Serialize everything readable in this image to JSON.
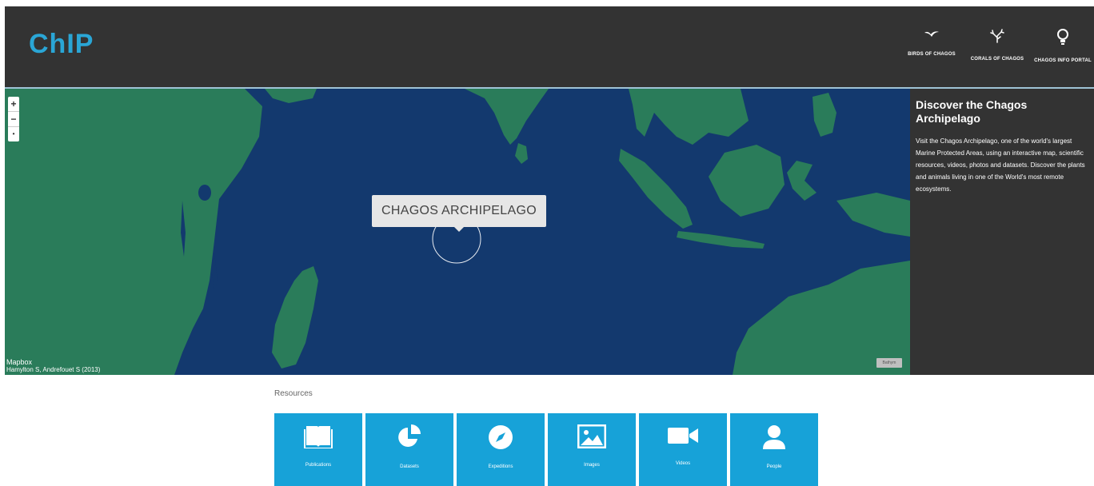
{
  "header": {
    "logo": "ChIP",
    "logo_subtitle": "",
    "nav": [
      {
        "label": "BIRDS OF CHAGOS",
        "icon": "bird-icon"
      },
      {
        "label": "CORALS OF CHAGOS",
        "icon": "coral-icon"
      },
      {
        "label": "CHAGOS INFO PORTAL",
        "icon": "lightbulb-icon"
      }
    ]
  },
  "map": {
    "zoom_in": "+",
    "zoom_out": "−",
    "reset": "•",
    "label": "CHAGOS ARCHIPELAGO",
    "attribution_logo": "Mapbox",
    "attribution": "Hamylton S, Andrefouet S (2013)",
    "corner_button": "Bathym"
  },
  "info": {
    "title": "Discover the Chagos Archipelago",
    "body": "Visit the Chagos Archipelago, one of the world's largest Marine Protected Areas, using an interactive map, scientific resources, videos, photos and datasets. Discover the plants and animals living in one of the World's most remote ecosystems."
  },
  "resources": {
    "title": "Resources",
    "tiles": [
      {
        "label": "Publications",
        "icon": "book-icon"
      },
      {
        "label": "Datasets",
        "icon": "pie-chart-icon"
      },
      {
        "label": "Expeditions",
        "icon": "compass-icon"
      },
      {
        "label": "Images",
        "icon": "image-icon"
      },
      {
        "label": "Videos",
        "icon": "video-camera-icon"
      },
      {
        "label": "People",
        "icon": "person-icon"
      }
    ]
  },
  "colors": {
    "header_bg": "#333333",
    "ocean": "#13396e",
    "land": "#2a7c5a",
    "tile_blue": "#17a2d8",
    "logo_blue": "#2aa6d6"
  }
}
